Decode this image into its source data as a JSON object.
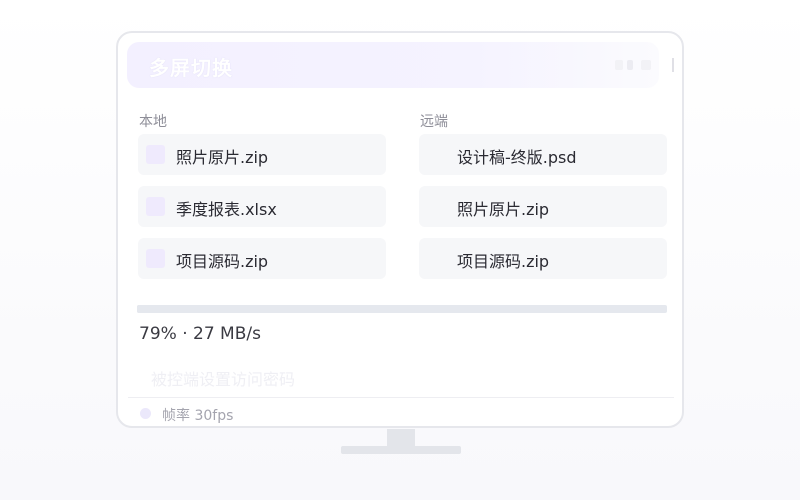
{
  "app": {
    "title": "多屏切换"
  },
  "columns": {
    "local_label": "本地",
    "remote_label": "远端"
  },
  "local_files": [
    {
      "name": "照片原片.zip"
    },
    {
      "name": "季度报表.xlsx"
    },
    {
      "name": "项目源码.zip"
    }
  ],
  "remote_files": [
    {
      "name": "设计稿-终版.psd"
    },
    {
      "name": "照片原片.zip"
    },
    {
      "name": "项目源码.zip"
    }
  ],
  "transfer": {
    "progress_text": "79% · 27 MB/s",
    "progress_fraction": 0.79
  },
  "password_hint": "被控端设置访问密码",
  "status": {
    "text": "帧率 30fps"
  },
  "colors": {
    "accent": "#efeafd",
    "title_gradient_start": "#f3f0ff",
    "item_background": "#f6f7f9"
  },
  "icons": {
    "file": "file-icon",
    "status": "status-dot-icon"
  }
}
